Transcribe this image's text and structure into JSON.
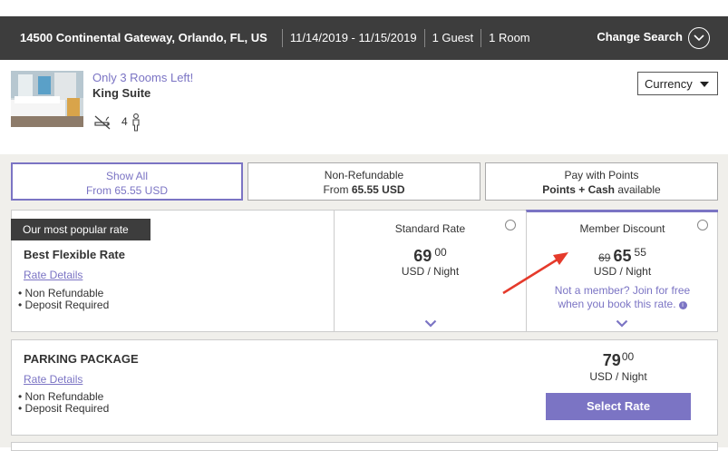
{
  "search": {
    "address": "14500 Continental Gateway, Orlando, FL, US",
    "dates": "11/14/2019 - 11/15/2019",
    "guests": "1 Guest",
    "rooms": "1 Room",
    "change_label": "Change Search"
  },
  "room": {
    "availability": "Only 3 Rooms Left!",
    "name": "King Suite",
    "occupancy": "4"
  },
  "currency": {
    "label": "Currency"
  },
  "tabs": [
    {
      "label": "Show All",
      "sub_prefix": "From",
      "sub_value": "65.55 USD"
    },
    {
      "label": "Non-Refundable",
      "sub_prefix": "From",
      "sub_value": "65.55 USD"
    },
    {
      "label": "Pay with Points",
      "sub_prefix": "Points + Cash",
      "sub_value": "available"
    }
  ],
  "rate": {
    "badge": "Our most popular rate",
    "name": "Best Flexible Rate",
    "details_link": "Rate Details",
    "bullets": [
      "Non Refundable",
      "Deposit Required"
    ],
    "standard": {
      "title": "Standard Rate",
      "price": "69",
      "cents": "00",
      "unit": "USD / Night"
    },
    "member": {
      "title": "Member Discount",
      "old_price": "69",
      "price": "65",
      "cents": "55",
      "unit": "USD / Night",
      "note_line1": "Not a member? Join for free",
      "note_line2": "when you book this rate."
    }
  },
  "parking": {
    "name": "PARKING PACKAGE",
    "details_link": "Rate Details",
    "bullets": [
      "Non Refundable",
      "Deposit Required"
    ],
    "price": "79",
    "cents": "00",
    "unit": "USD / Night",
    "button": "Select Rate"
  },
  "colors": {
    "accent": "#7b74c4",
    "bar": "#3d3d3d",
    "arrow": "#e53a2b"
  }
}
